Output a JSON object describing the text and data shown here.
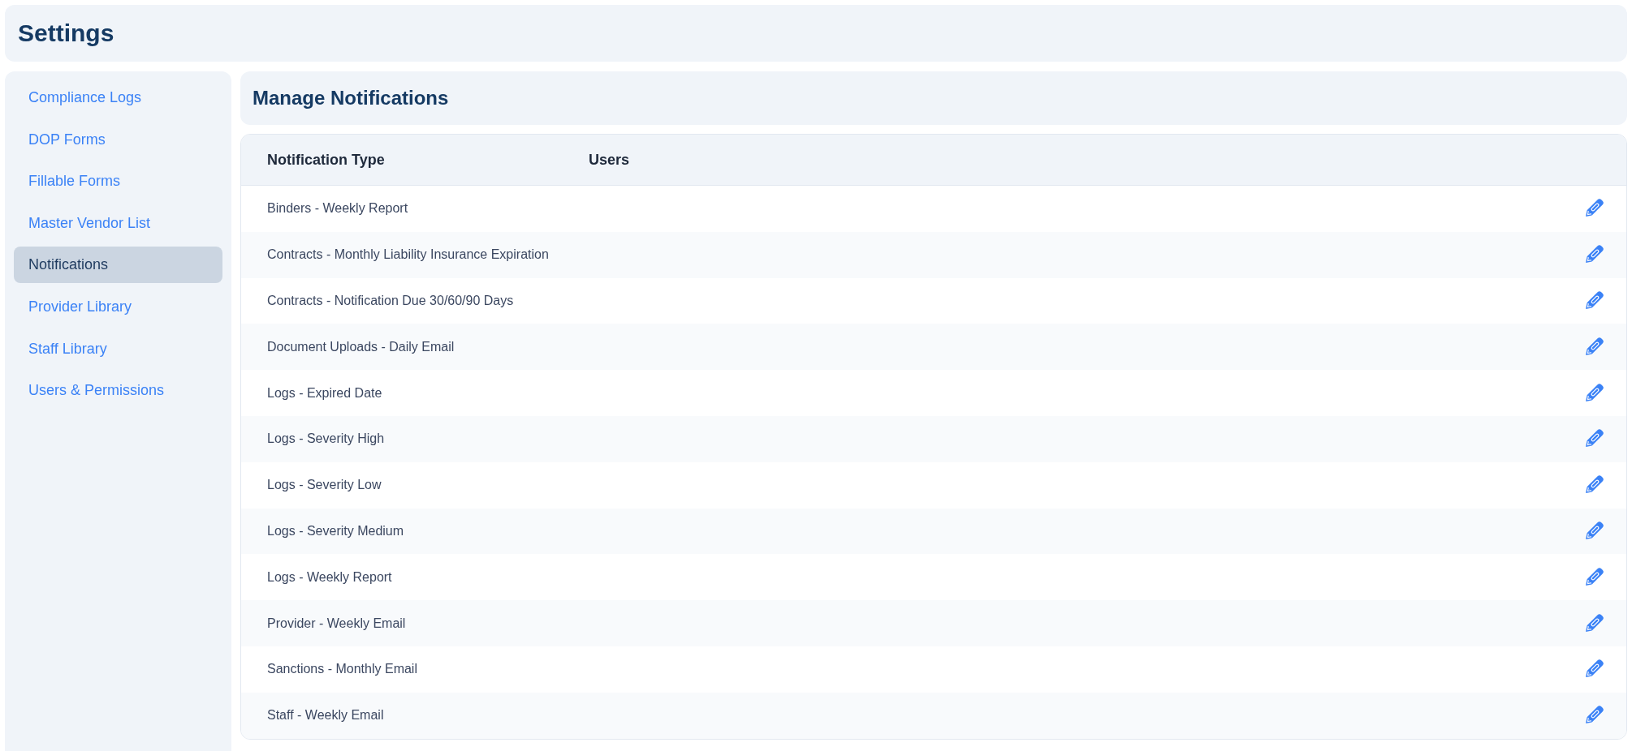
{
  "header": {
    "title": "Settings"
  },
  "sidebar": {
    "items": [
      {
        "label": "Compliance Logs",
        "selected": false
      },
      {
        "label": "DOP Forms",
        "selected": false
      },
      {
        "label": "Fillable Forms",
        "selected": false
      },
      {
        "label": "Master Vendor List",
        "selected": false
      },
      {
        "label": "Notifications",
        "selected": true
      },
      {
        "label": "Provider Library",
        "selected": false
      },
      {
        "label": "Staff Library",
        "selected": false
      },
      {
        "label": "Users & Permissions",
        "selected": false
      }
    ]
  },
  "panel": {
    "title": "Manage Notifications"
  },
  "table": {
    "columns": [
      "Notification Type",
      "Users"
    ],
    "rows": [
      {
        "notification_type": "Binders - Weekly Report"
      },
      {
        "notification_type": "Contracts - Monthly Liability Insurance Expiration"
      },
      {
        "notification_type": "Contracts - Notification Due 30/60/90 Days"
      },
      {
        "notification_type": "Document Uploads - Daily Email"
      },
      {
        "notification_type": "Logs - Expired Date"
      },
      {
        "notification_type": "Logs - Severity High"
      },
      {
        "notification_type": "Logs - Severity Low"
      },
      {
        "notification_type": "Logs - Severity Medium"
      },
      {
        "notification_type": "Logs - Weekly Report"
      },
      {
        "notification_type": "Provider - Weekly Email"
      },
      {
        "notification_type": "Sanctions - Monthly Email"
      },
      {
        "notification_type": "Staff - Weekly Email"
      }
    ]
  }
}
